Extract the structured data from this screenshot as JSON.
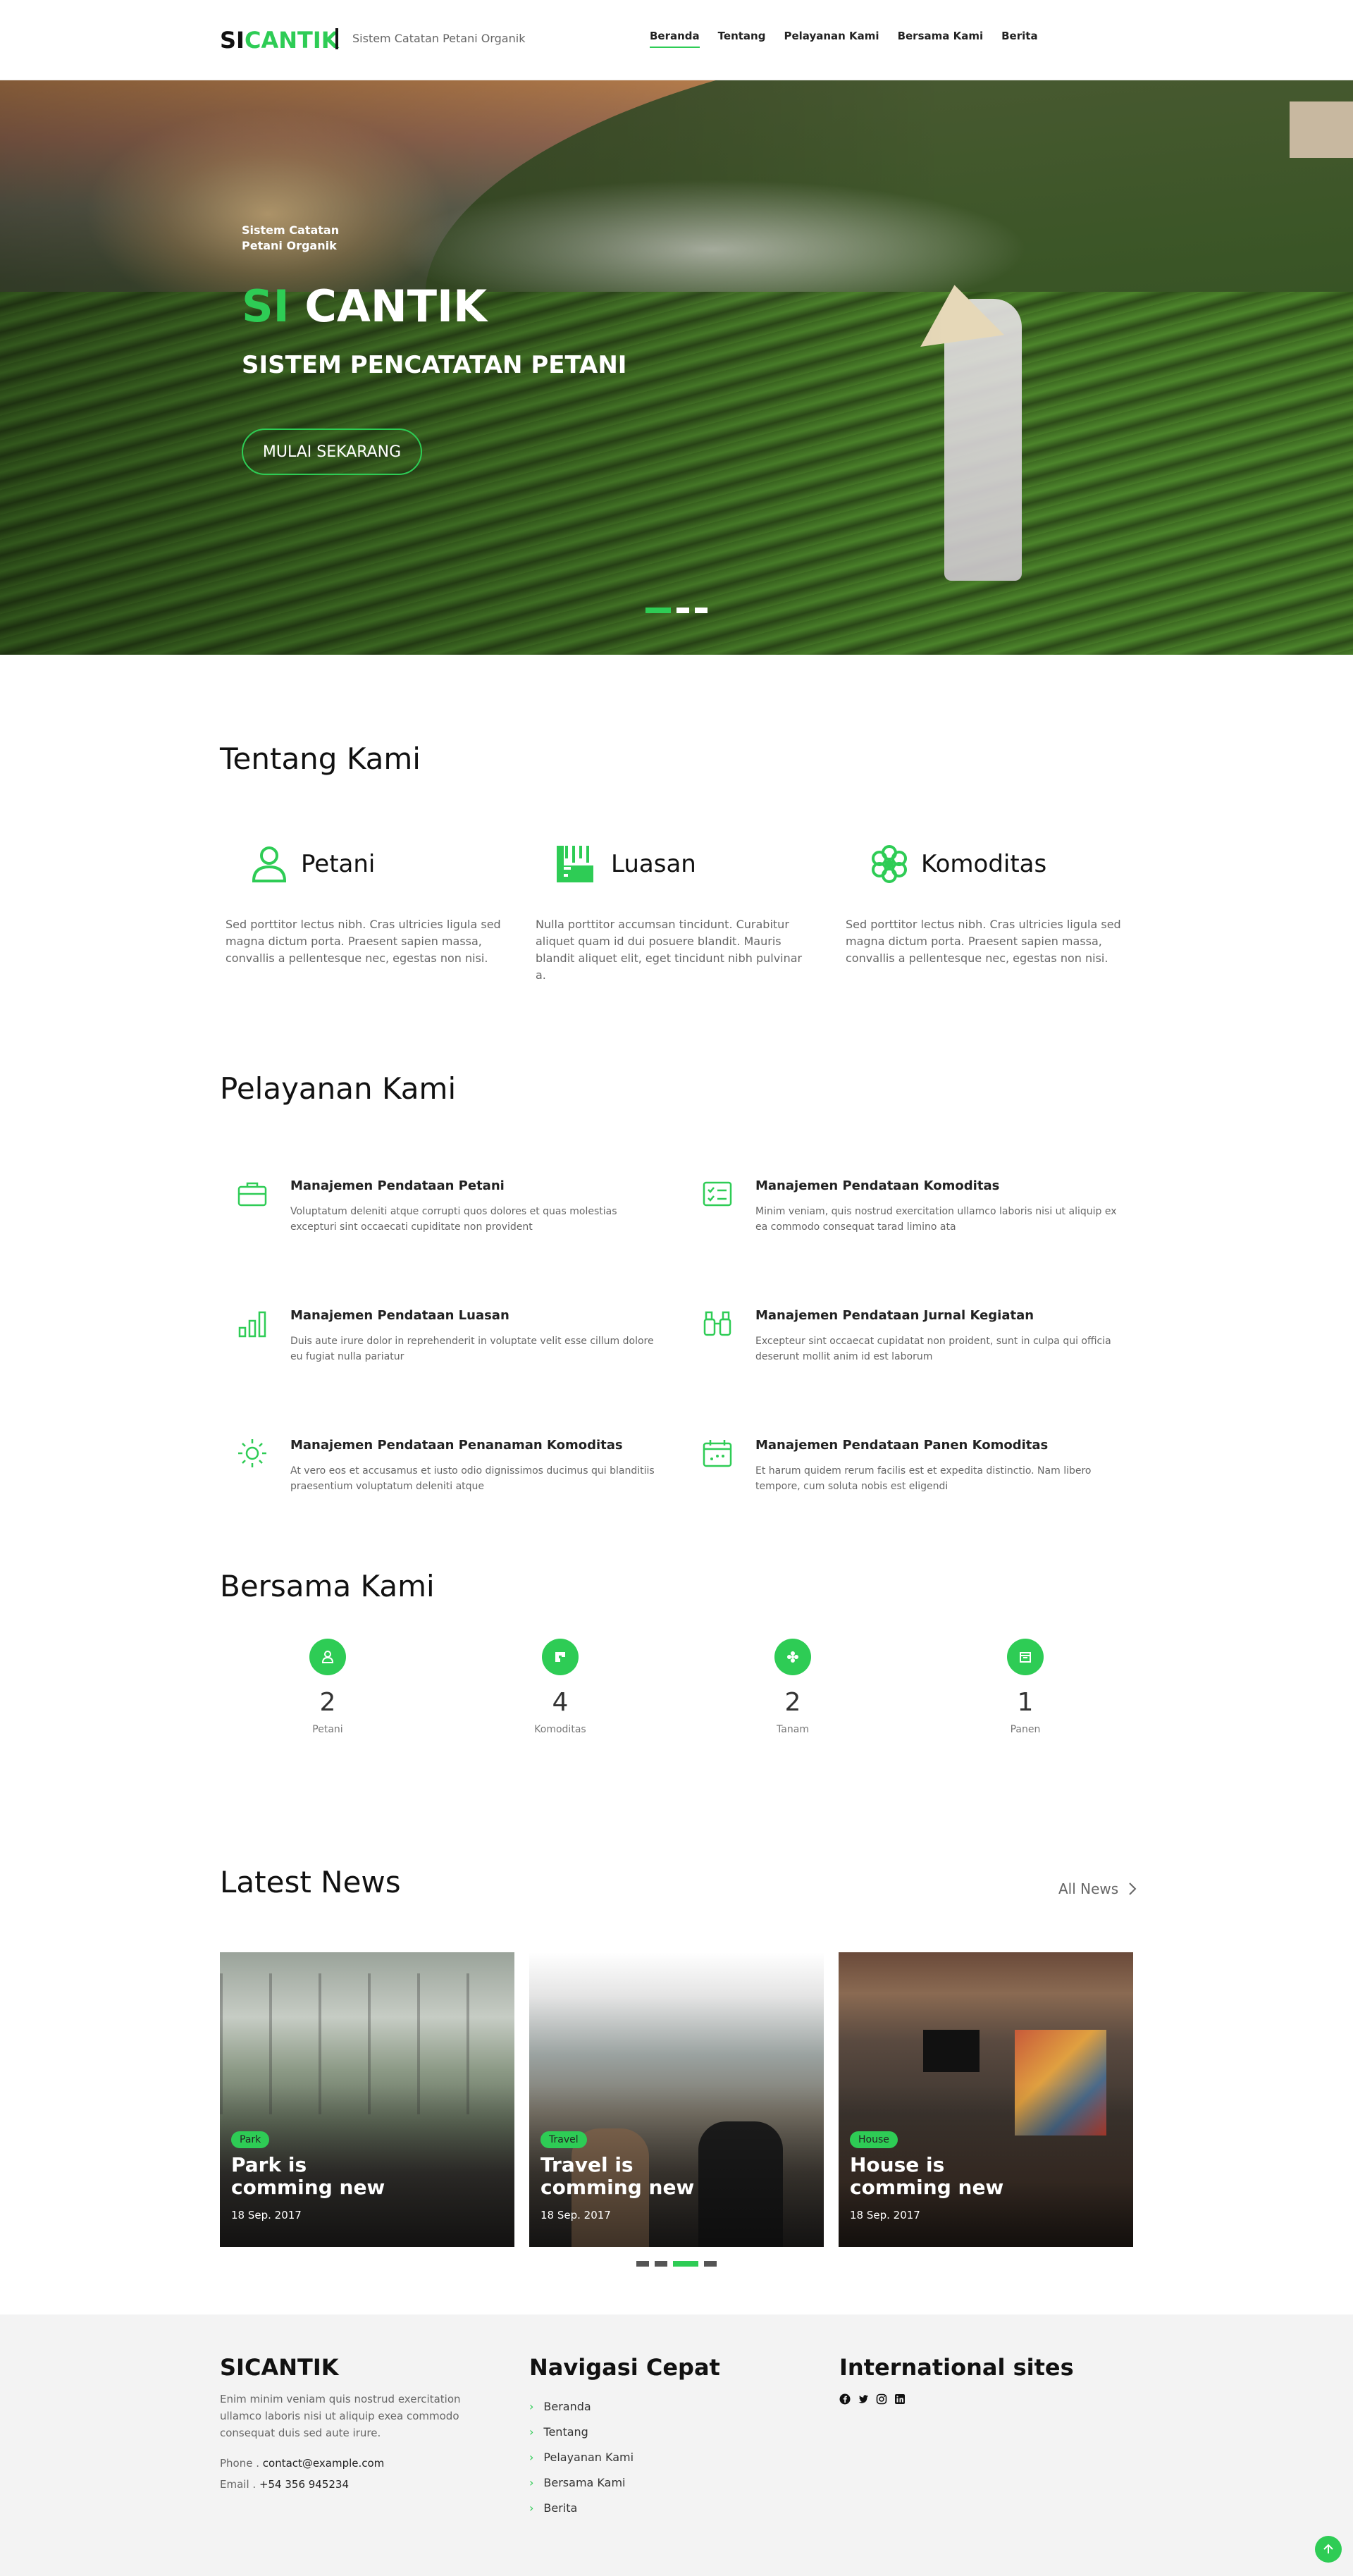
{
  "header": {
    "logo_si": "SI",
    "logo_cantik": "CANTIK",
    "tagline": "Sistem Catatan Petani Organik",
    "nav": [
      "Beranda",
      "Tentang",
      "Pelayanan Kami",
      "Bersama Kami",
      "Berita"
    ]
  },
  "hero": {
    "small": "Sistem Catatan Petani Organik",
    "title_si": "SI",
    "title_cantik": "CANTIK",
    "subtitle": "SISTEM PENCATATAN PETANI",
    "button": "MULAI SEKARANG",
    "slide_count": 3,
    "active_slide": 1
  },
  "about": {
    "title": "Tentang Kami",
    "cards": [
      {
        "label": "Petani",
        "icon": "person-icon",
        "desc": "Sed porttitor lectus nibh. Cras ultricies ligula sed magna dictum porta. Praesent sapien massa, convallis a pellentesque nec, egestas non nisi."
      },
      {
        "label": "Luasan",
        "icon": "ruler-icon",
        "desc": "Nulla porttitor accumsan tincidunt. Curabitur aliquet quam id dui posuere blandit. Mauris blandit aliquet elit, eget tincidunt nibh pulvinar a."
      },
      {
        "label": "Komoditas",
        "icon": "flower-icon",
        "desc": "Sed porttitor lectus nibh. Cras ultricies ligula sed magna dictum porta. Praesent sapien massa, convallis a pellentesque nec, egestas non nisi."
      }
    ]
  },
  "services": {
    "title": "Pelayanan Kami",
    "items": [
      {
        "title": "Manajemen Pendataan Petani",
        "icon": "briefcase-icon",
        "desc": "Voluptatum deleniti atque corrupti quos dolores et quas molestias excepturi sint occaecati cupiditate non provident"
      },
      {
        "title": "Manajemen Pendataan Komoditas",
        "icon": "checklist-icon",
        "desc": "Minim veniam, quis nostrud exercitation ullamco laboris nisi ut aliquip ex ea commodo consequat tarad limino ata"
      },
      {
        "title": "Manajemen Pendataan Luasan",
        "icon": "bar-chart-icon",
        "desc": "Duis aute irure dolor in reprehenderit in voluptate velit esse cillum dolore eu fugiat nulla pariatur"
      },
      {
        "title": "Manajemen Pendataan Jurnal Kegiatan",
        "icon": "binoculars-icon",
        "desc": "Excepteur sint occaecat cupidatat non proident, sunt in culpa qui officia deserunt mollit anim id est laborum"
      },
      {
        "title": "Manajemen Pendataan Penanaman Komoditas",
        "icon": "sun-icon",
        "desc": "At vero eos et accusamus et iusto odio dignissimos ducimus qui blanditiis praesentium voluptatum deleniti atque"
      },
      {
        "title": "Manajemen Pendataan Panen Komoditas",
        "icon": "calendar-icon",
        "desc": "Et harum quidem rerum facilis est et expedita distinctio. Nam libero tempore, cum soluta nobis est eligendi"
      }
    ]
  },
  "stats": {
    "title": "Bersama Kami",
    "items": [
      {
        "value": "2",
        "label": "Petani",
        "icon": "person-icon"
      },
      {
        "value": "4",
        "label": "Komoditas",
        "icon": "flag-icon"
      },
      {
        "value": "2",
        "label": "Tanam",
        "icon": "flower-icon"
      },
      {
        "value": "1",
        "label": "Panen",
        "icon": "box-icon"
      }
    ]
  },
  "news": {
    "title": "Latest News",
    "all_label": "All News",
    "cards": [
      {
        "tag": "Park",
        "title": "Park is comming new",
        "date": "18 Sep. 2017"
      },
      {
        "tag": "Travel",
        "title": "Travel is comming new",
        "date": "18 Sep. 2017"
      },
      {
        "tag": "House",
        "title": "House is comming new",
        "date": "18 Sep. 2017"
      }
    ],
    "page_count": 4,
    "active_page": 3
  },
  "footer": {
    "brand": "SICANTIK",
    "about": "Enim minim veniam quis nostrud exercitation ullamco laboris nisi ut aliquip exea commodo consequat duis sed aute irure.",
    "phone_label": "Phone .",
    "phone": "contact@example.com",
    "email_label": "Email .",
    "email": "+54 356 945234",
    "nav_title": "Navigasi Cepat",
    "nav": [
      "Beranda",
      "Tentang",
      "Pelayanan Kami",
      "Bersama Kami",
      "Berita"
    ],
    "intl_title": "International sites",
    "social": [
      "facebook-icon",
      "twitter-icon",
      "instagram-icon",
      "linkedin-icon"
    ]
  },
  "colors": {
    "accent": "#2ecc55",
    "footer_bg": "#f3f3f3"
  }
}
